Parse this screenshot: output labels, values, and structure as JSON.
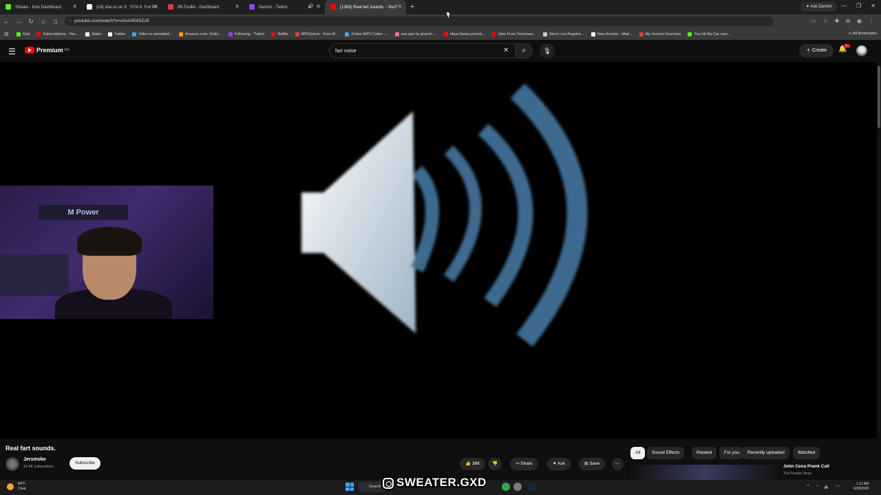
{
  "browser": {
    "tabs": [
      {
        "label": "Stream - Kick Dashboard",
        "icon": "kick-icon",
        "color": "#53fc18"
      },
      {
        "label": "(19) sha us on X: \"GTA 6: Full Ri",
        "icon": "x-icon",
        "color": "#ffffff"
      },
      {
        "label": "IRLToolkit - Dashboard",
        "icon": "irltoolkit-icon",
        "color": "#e23b3b"
      },
      {
        "label": "Narmin - Twitch",
        "icon": "twitch-icon",
        "color": "#9146ff"
      },
      {
        "label": "(1363) Real fart sounds. - YouT",
        "icon": "youtube-icon",
        "color": "#ff0000"
      }
    ],
    "new_tab": "+",
    "ask_gemini": "Ask Gemini",
    "url": "youtube.com/watch?v=vAuA4E83ZzE",
    "bookmarks": [
      {
        "label": "Kick",
        "color": "#53fc18"
      },
      {
        "label": "Subscriptions - You...",
        "color": "#ff0000"
      },
      {
        "label": "Stake",
        "color": "#ffffff"
      },
      {
        "label": "Twitter",
        "color": "#ffffff"
      },
      {
        "label": "Video to animated...",
        "color": "#3ea6ff"
      },
      {
        "label": "Amazon.com: Onlin...",
        "color": "#ff9900"
      },
      {
        "label": "Following - Twitch",
        "color": "#9146ff"
      },
      {
        "label": "Netflix",
        "color": "#e50914"
      },
      {
        "label": "MP3Juices - Free M...",
        "color": "#e23b3b"
      },
      {
        "label": "Online MP3 Cutter -...",
        "color": "#3ea6ff"
      },
      {
        "label": "osu-pps by grumd -...",
        "color": "#ff66aa"
      },
      {
        "label": "https://www.youtub...",
        "color": "#ff0000"
      },
      {
        "label": "John From Tennesse...",
        "color": "#ff0000"
      },
      {
        "label": "Men's Los Angeles...",
        "color": "#cccccc"
      },
      {
        "label": "New Arrivals - Mad...",
        "color": "#ffffff"
      },
      {
        "label": "My Verizon Overview",
        "color": "#e23b3b"
      },
      {
        "label": "You Hit My Car reac...",
        "color": "#53fc18"
      }
    ],
    "all_bookmarks": "All Bookmarks"
  },
  "youtube": {
    "logo_text": "Premium",
    "logo_region": "MX",
    "search_value": "fart noise",
    "create_label": "Create",
    "notification_count": "9+",
    "video": {
      "title": "Real fart sounds.",
      "channel": "Jersmoke",
      "subscribers": "16.8K subscribers",
      "subscribe_label": "Subscribe",
      "likes": "38K",
      "share_label": "Share",
      "ask_label": "Ask",
      "save_label": "Save"
    },
    "chips": [
      "All",
      "Sound Effects",
      "Related",
      "For you",
      "Recently uploaded",
      "Watched"
    ],
    "recommendation": {
      "title": "John Cena Prank Call",
      "channel": "The Prankie Show"
    }
  },
  "webcam": {
    "banner_text": "M Power"
  },
  "overlay": {
    "handle": "SWEATER.GXD"
  },
  "taskbar": {
    "temperature": "84°F",
    "weather": "Clear",
    "search_label": "Search",
    "time": "1:11 AM",
    "date": "6/28/2026"
  },
  "colors": {
    "accent": "#ff0000",
    "speaker_wave": "#3d6a8e",
    "speaker_body": "#e8eef4"
  }
}
